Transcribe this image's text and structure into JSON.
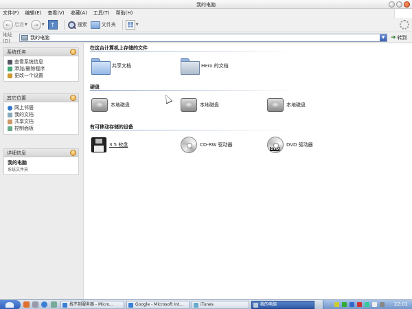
{
  "window": {
    "title": "我的电脑"
  },
  "menu": [
    "文件(F)",
    "编辑(E)",
    "查看(V)",
    "收藏(A)",
    "工具(T)",
    "帮助(H)"
  ],
  "toolbar": {
    "back": "后退",
    "search": "搜索",
    "folders": "文件夹"
  },
  "address": {
    "label": "地址(D)",
    "value": "我的电脑",
    "go": "转到"
  },
  "sidebar": {
    "system_tasks": {
      "title": "系统任务",
      "items": [
        "查看系统信息",
        "添加/删除程序",
        "更改一个设置"
      ]
    },
    "other_places": {
      "title": "其它位置",
      "items": [
        "网上邻居",
        "我的文档",
        "共享文档",
        "控制面板"
      ]
    },
    "details": {
      "title": "详细信息",
      "name": "我的电脑",
      "type": "系统文件夹"
    }
  },
  "groups": {
    "stored": {
      "title": "在这台计算机上存储的文件",
      "items": [
        "共享文档",
        "Hero 的文档"
      ]
    },
    "hdd": {
      "title": "硬盘",
      "items": [
        "本地磁盘",
        "本地磁盘",
        "本地磁盘"
      ]
    },
    "removable": {
      "title": "有可移动存储的设备",
      "items": [
        "3.5 软盘",
        "CD-RW 驱动器",
        "DVD 驱动器"
      ]
    }
  },
  "taskbar": {
    "tasks": [
      "找不到服务器 - Micro...",
      "Google - Microsoft Int...",
      "iTunes",
      "我的电脑"
    ],
    "clock": "22:01"
  },
  "colors": {
    "accent": "#2f5fb8",
    "tray": "#6f93c8"
  }
}
